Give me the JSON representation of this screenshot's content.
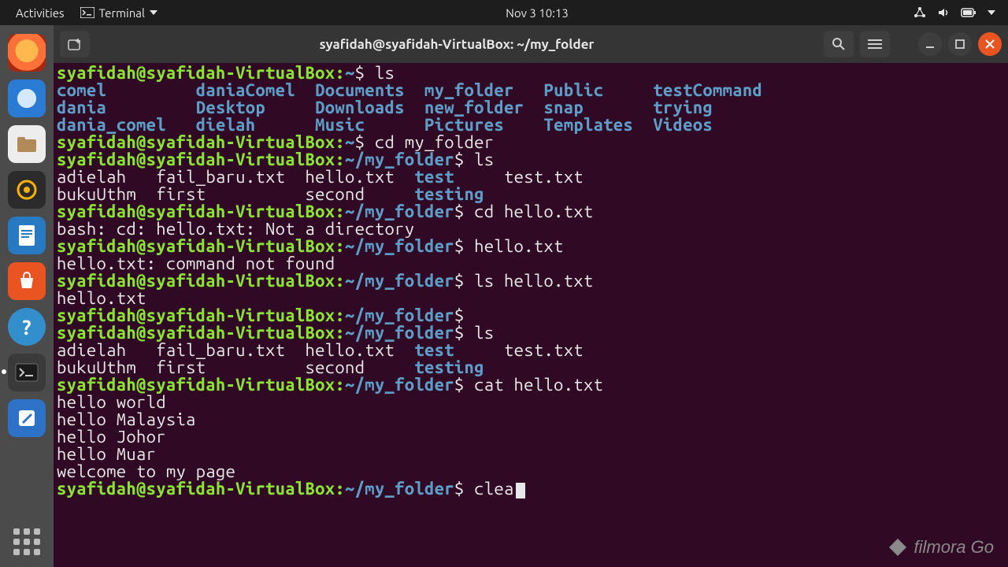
{
  "topbar": {
    "activities": "Activities",
    "app_label": "Terminal",
    "clock": "Nov 3  10:13"
  },
  "dock": {
    "items": [
      {
        "name": "firefox"
      },
      {
        "name": "thunderbird"
      },
      {
        "name": "files"
      },
      {
        "name": "rhythmbox"
      },
      {
        "name": "libreoffice-writer"
      },
      {
        "name": "ubuntu-software"
      },
      {
        "name": "help"
      },
      {
        "name": "terminal",
        "active": true
      },
      {
        "name": "text-editor"
      }
    ]
  },
  "window": {
    "title": "syafidah@syafidah-VirtualBox: ~/my_folder"
  },
  "prompt": {
    "user_host": "syafidah@syafidah-VirtualBox",
    "home": "~",
    "folder": "~/my_folder",
    "sym": "$"
  },
  "cmds": {
    "ls": "ls",
    "cd_my_folder": "cd my_folder",
    "cd_hello": "cd hello.txt",
    "hello_txt": "hello.txt",
    "ls_hello": "ls hello.txt",
    "cat_hello": "cat hello.txt",
    "clea": "clea"
  },
  "home_ls": {
    "r1": [
      "comel",
      "daniaComel",
      "Documents",
      "my_folder",
      "Public",
      "testCommand"
    ],
    "r2": [
      "dania",
      "Desktop",
      "Downloads",
      "new_folder",
      "snap",
      "trying"
    ],
    "r3": [
      "dania_comel",
      "dielah",
      "Music",
      "Pictures",
      "Templates",
      "Videos"
    ]
  },
  "folder_ls": {
    "r1": [
      "adielah",
      "fail_baru.txt",
      "hello.txt",
      "test",
      "test.txt"
    ],
    "r2": [
      "bukuUthm",
      "first",
      "second",
      "testing"
    ]
  },
  "errors": {
    "not_dir": "bash: cd: hello.txt: Not a directory",
    "cmd_not_found": "hello.txt: command not found"
  },
  "ls_hello_out": "hello.txt",
  "cat_out": [
    "hello world",
    "hello Malaysia",
    "hello Johor",
    "hello Muar",
    "welcome to my page"
  ],
  "watermark": "filmora Go"
}
